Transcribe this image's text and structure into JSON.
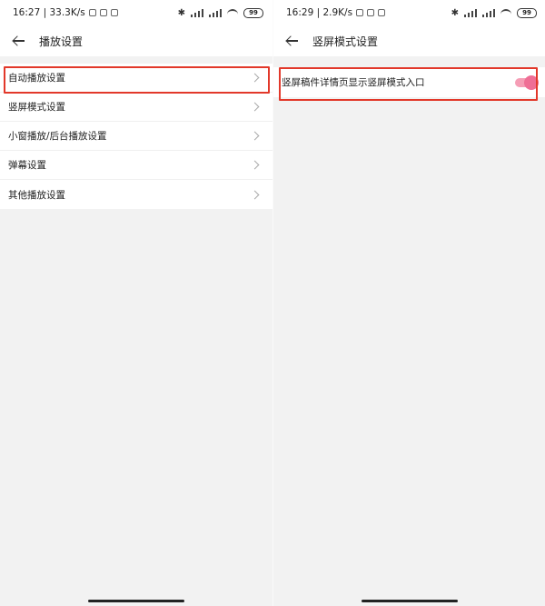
{
  "screens": [
    {
      "status": {
        "time_speed": "16:27 | 33.3K/s",
        "battery": "99"
      },
      "title": "播放设置",
      "rows": [
        {
          "label": "自动播放设置"
        },
        {
          "label": "竖屏模式设置"
        },
        {
          "label": "小窗播放/后台播放设置"
        },
        {
          "label": "弹幕设置"
        },
        {
          "label": "其他播放设置"
        }
      ]
    },
    {
      "status": {
        "time_speed": "16:29 | 2.9K/s",
        "battery": "99"
      },
      "title": "竖屏模式设置",
      "toggle_row": {
        "label": "竖屏稿件详情页显示竖屏模式入口",
        "on": true
      }
    }
  ],
  "colors": {
    "highlight": "#e2382a",
    "toggle_on": "#ef6e95"
  }
}
